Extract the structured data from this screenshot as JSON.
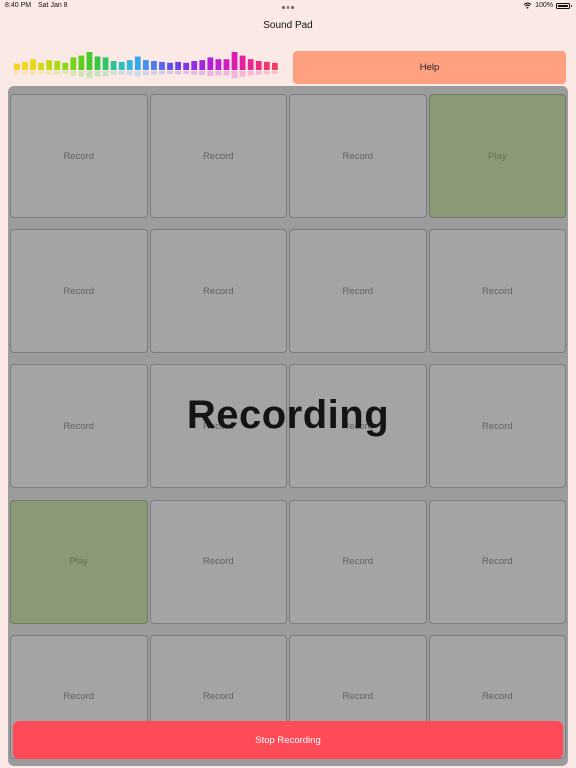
{
  "status": {
    "time": "8:40 PM",
    "date": "Sat Jan 8",
    "battery": "100%",
    "battery_level": 1.0
  },
  "app": {
    "title": "Sound Pad"
  },
  "meter": {
    "levels": [
      0.35,
      0.45,
      0.6,
      0.4,
      0.55,
      0.5,
      0.4,
      0.7,
      0.8,
      1.0,
      0.75,
      0.7,
      0.5,
      0.45,
      0.55,
      0.75,
      0.55,
      0.5,
      0.45,
      0.4,
      0.45,
      0.4,
      0.5,
      0.55,
      0.7,
      0.6,
      0.6,
      1.0,
      0.8,
      0.6,
      0.5,
      0.45,
      0.4
    ],
    "colors": [
      "#f7d21c",
      "#f3d41a",
      "#e6d817",
      "#d4d915",
      "#c2da14",
      "#a8db14",
      "#8fd816",
      "#78d41a",
      "#5fcf1f",
      "#48ca2c",
      "#3bc746",
      "#33c46a",
      "#2ec194",
      "#2cbdbc",
      "#2fb6dd",
      "#38a6ec",
      "#4391ef",
      "#4d7bef",
      "#5766ee",
      "#6152ec",
      "#6d43e9",
      "#7e37e6",
      "#912de2",
      "#a326de",
      "#b51fd9",
      "#c41cd0",
      "#d11bc3",
      "#db1db2",
      "#e321a0",
      "#e9278f",
      "#ed2e7f",
      "#ef3671",
      "#f03e64"
    ]
  },
  "help": {
    "label": "Help"
  },
  "pads": [
    {
      "label": "Record",
      "state": "record"
    },
    {
      "label": "Record",
      "state": "record"
    },
    {
      "label": "Record",
      "state": "record"
    },
    {
      "label": "Play",
      "state": "play"
    },
    {
      "label": "Record",
      "state": "record"
    },
    {
      "label": "Record",
      "state": "record"
    },
    {
      "label": "Record",
      "state": "record"
    },
    {
      "label": "Record",
      "state": "record"
    },
    {
      "label": "Record",
      "state": "record"
    },
    {
      "label": "Record",
      "state": "record"
    },
    {
      "label": "Record",
      "state": "record"
    },
    {
      "label": "Record",
      "state": "record"
    },
    {
      "label": "Play",
      "state": "play"
    },
    {
      "label": "Record",
      "state": "record"
    },
    {
      "label": "Record",
      "state": "record"
    },
    {
      "label": "Record",
      "state": "record"
    },
    {
      "label": "Record",
      "state": "record"
    },
    {
      "label": "Record",
      "state": "record"
    },
    {
      "label": "Record",
      "state": "record"
    },
    {
      "label": "Record",
      "state": "record"
    }
  ],
  "overlay": {
    "label": "Recording"
  },
  "stop": {
    "label": "Stop Recording"
  },
  "colors": {
    "background": "#fbe9e6",
    "help_button": "#ffa180",
    "pad": "#a4a4a4",
    "pad_play": "#8a9a76",
    "stop_button": "#ff4b57"
  }
}
